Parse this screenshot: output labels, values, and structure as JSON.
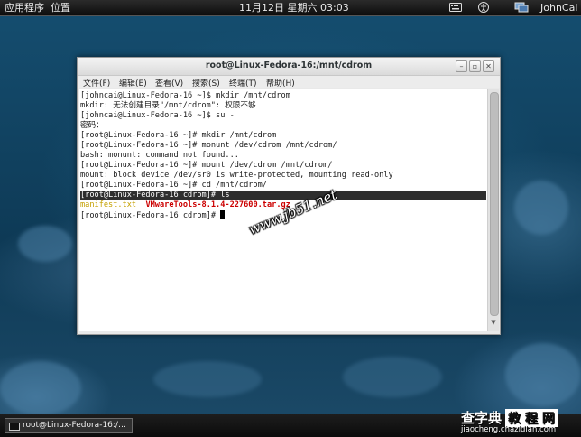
{
  "panel": {
    "applications": "应用程序",
    "places": "位置",
    "clock": "11月12日 星期六 03:03",
    "user": "JohnCai",
    "icons": [
      "keyboard-icon",
      "accessibility-icon",
      "network-icon"
    ]
  },
  "window": {
    "title": "root@Linux-Fedora-16:/mnt/cdrom",
    "buttons": {
      "minimize": "–",
      "maximize": "▫",
      "close": "✕"
    },
    "menu": [
      "文件(F)",
      "编辑(E)",
      "查看(V)",
      "搜索(S)",
      "终端(T)",
      "帮助(H)"
    ]
  },
  "terminal": {
    "lines": [
      "[johncai@Linux-Fedora-16 ~]$ mkdir /mnt/cdrom",
      "mkdir: 无法创建目录\"/mnt/cdrom\": 权限不够",
      "[johncai@Linux-Fedora-16 ~]$ su -",
      "密码：",
      "[root@Linux-Fedora-16 ~]# mkdir /mnt/cdrom",
      "[root@Linux-Fedora-16 ~]# monunt /dev/cdrom /mnt/cdrom/",
      "bash: monunt: command not found...",
      "[root@Linux-Fedora-16 ~]# mount /dev/cdrom /mnt/cdrom/",
      "mount: block device /dev/sr0 is write-protected, mounting read-only",
      "[root@Linux-Fedora-16 ~]# cd /mnt/cdrom/",
      "[root@Linux-Fedora-16 cdrom]# ls"
    ],
    "files": [
      "manifest.txt",
      "VMwareTools-8.1.4-227600.tar.gz"
    ],
    "prompt": "[root@Linux-Fedora-16 cdrom]# "
  },
  "taskbar": {
    "item": "root@Linux-Fedora-16:/…"
  },
  "watermarks": {
    "diagonal": "www.jb51.net",
    "logo_text": "查字典",
    "logo_box": "教 程 网",
    "logo_url": "jiaocheng.chazidian.com"
  },
  "colors": {
    "file_yellow": "#c4a000",
    "file_red": "#cc0000",
    "highlight": "#2e2e2e"
  }
}
